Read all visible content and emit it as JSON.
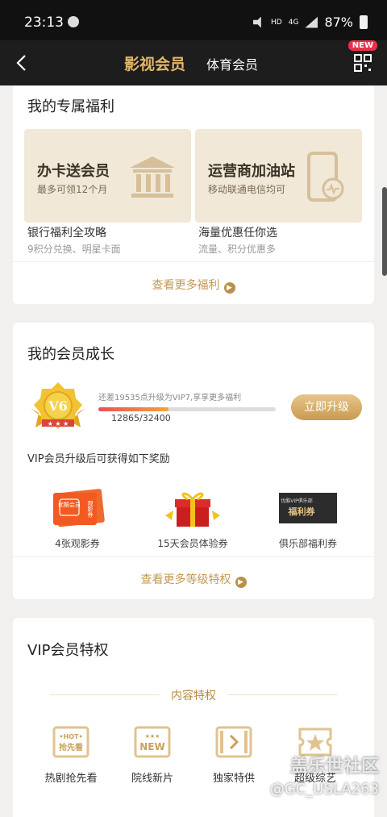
{
  "status_bar": {
    "time": "23:13",
    "network": "4G",
    "battery": "87%"
  },
  "nav": {
    "tabs": [
      {
        "label": "影视会员",
        "active": true
      },
      {
        "label": "体育会员",
        "active": false
      }
    ],
    "new_badge": "NEW",
    "accent_color": "#e2b76a"
  },
  "benefits": {
    "title": "我的专属福利",
    "items": [
      {
        "title": "办卡送会员",
        "subtitle": "最多可领12个月",
        "caption": "银行福利全攻略",
        "caption_sub": "9积分兑换、明星卡面",
        "icon": "bank-icon"
      },
      {
        "title": "运营商加油站",
        "subtitle": "移动联通电信均可",
        "caption": "海量优惠任你选",
        "caption_sub": "流量、积分优惠多",
        "icon": "phone-icon"
      }
    ],
    "more": "查看更多福利"
  },
  "growth": {
    "title": "我的会员成长",
    "level": "V6",
    "progress_tip": "还差19535点升级为VIP7,享享更多福利",
    "progress_text": "12865/32400",
    "progress_fraction": 0.397,
    "upgrade_label": "立即升级",
    "reward_intro": "VIP会员升级后可获得如下奖励",
    "rewards": [
      {
        "caption": "4张观影券",
        "tag": "优酷会员",
        "side": "观影券",
        "icon": "movie-ticket-icon"
      },
      {
        "caption": "15天会员体验券",
        "tag": "¥",
        "icon": "gift-box-icon"
      },
      {
        "caption": "俱乐部福利券",
        "tag": "优酷VIP俱乐部",
        "main": "福利券",
        "icon": "club-voucher-icon"
      }
    ],
    "more": "查看更多等级特权"
  },
  "privileges": {
    "title": "VIP会员特权",
    "section": "内容特权",
    "items": [
      {
        "caption": "热剧抢先看",
        "tag_top": "•HOT•",
        "tag_main": "抢先看",
        "icon": "hot-preview-icon"
      },
      {
        "caption": "院线新片",
        "tag_top": "★★★",
        "tag_main": "NEW",
        "icon": "new-release-icon"
      },
      {
        "caption": "独家特供",
        "icon": "film-play-icon"
      },
      {
        "caption": "超级综艺",
        "icon": "star-ticket-icon"
      }
    ]
  },
  "watermark": {
    "line1": "盖乐世社区",
    "line2": "@GC_USLA263"
  }
}
